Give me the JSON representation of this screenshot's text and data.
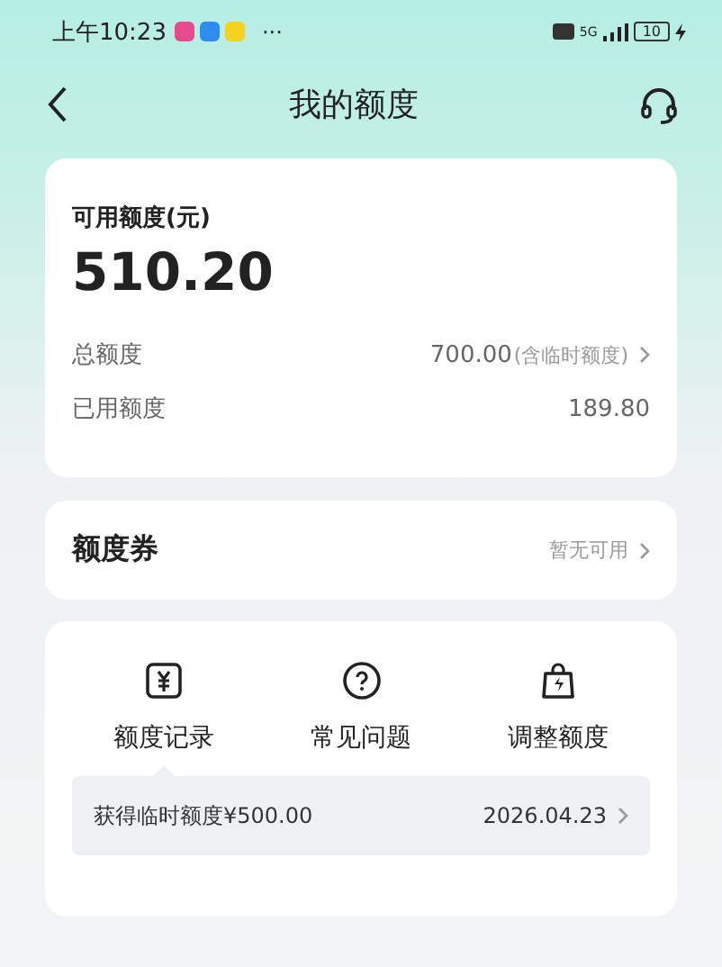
{
  "status_bar": {
    "time": "上午10:23",
    "more": "···",
    "network": "5G",
    "battery": "10"
  },
  "header": {
    "title": "我的额度"
  },
  "quota_card": {
    "label": "可用额度(元)",
    "amount": "510.20",
    "rows": [
      {
        "label": "总额度",
        "value": "700.00",
        "note": "(含临时额度)",
        "link": true
      },
      {
        "label": "已用额度",
        "value": "189.80",
        "link": false
      }
    ]
  },
  "coupon": {
    "label": "额度券",
    "status": "暂无可用"
  },
  "actions": [
    {
      "kind": "yuan",
      "label": "额度记录",
      "selected": true
    },
    {
      "kind": "question",
      "label": "常见问题",
      "selected": false
    },
    {
      "kind": "bag",
      "label": "调整额度",
      "selected": false
    }
  ],
  "record": {
    "text": "获得临时额度¥500.00",
    "date": "2026.04.23"
  }
}
